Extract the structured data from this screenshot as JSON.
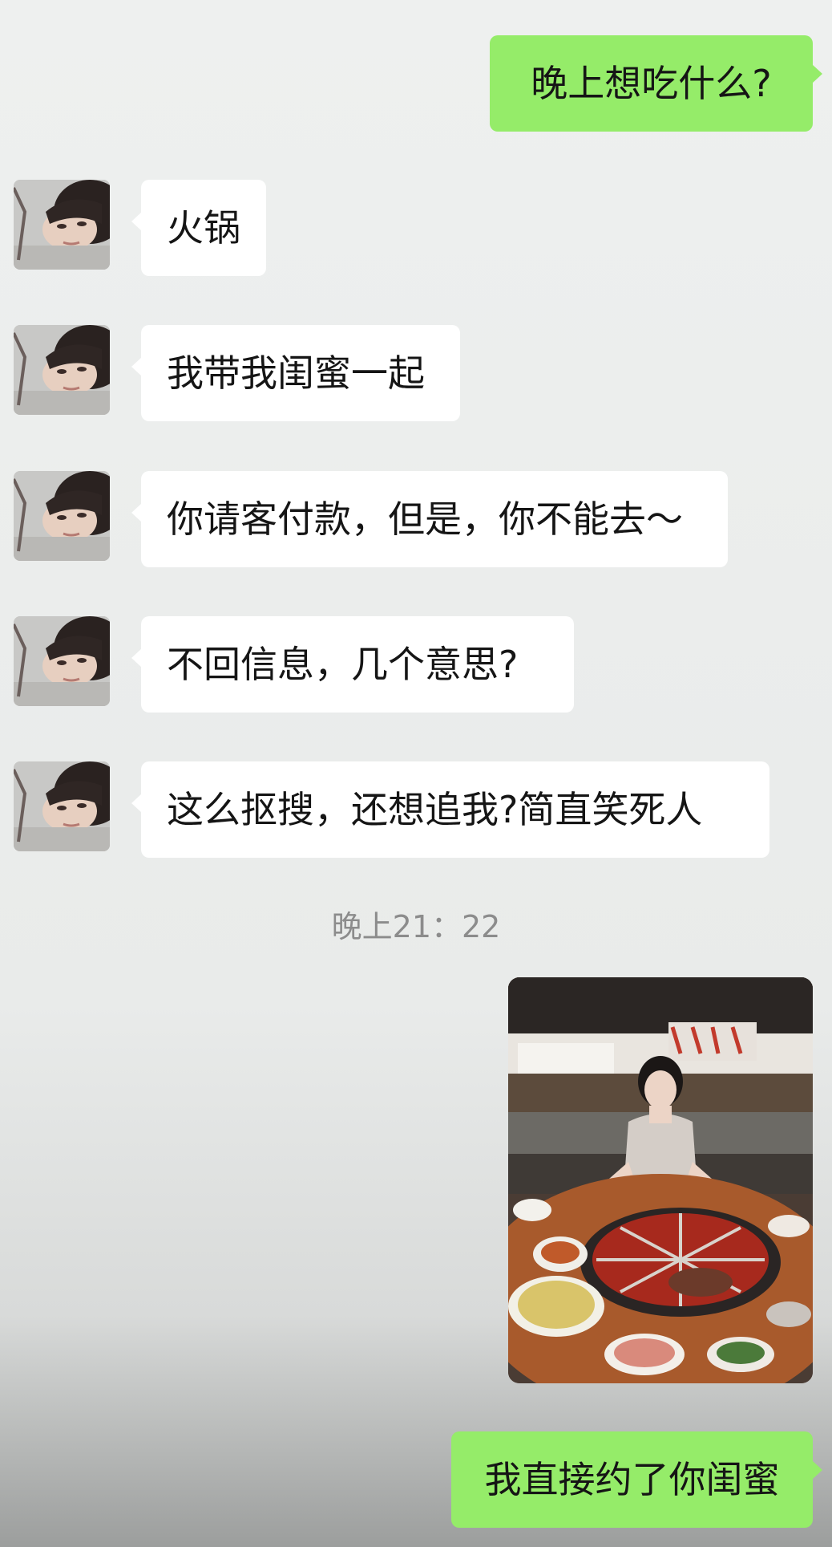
{
  "chat": {
    "messages": [
      {
        "sender": "me",
        "type": "text",
        "text": "晚上想吃什么?"
      },
      {
        "sender": "other",
        "type": "text",
        "text": "火锅",
        "avatar": "woman-avatar"
      },
      {
        "sender": "other",
        "type": "text",
        "text": "我带我闺蜜一起",
        "avatar": "woman-avatar"
      },
      {
        "sender": "other",
        "type": "text",
        "text": "你请客付款，但是，你不能去～",
        "avatar": "woman-avatar"
      },
      {
        "sender": "other",
        "type": "text",
        "text": "不回信息，几个意思?",
        "avatar": "woman-avatar"
      },
      {
        "sender": "other",
        "type": "text",
        "text": "这么抠搜，还想追我?简直笑死人",
        "avatar": "woman-avatar"
      }
    ],
    "timestamp": "晚上21：22",
    "image_message": {
      "sender": "me",
      "type": "image",
      "subject": "hotpot-photo"
    },
    "last_message": {
      "sender": "me",
      "type": "text",
      "text": "我直接约了你闺蜜"
    }
  },
  "colors": {
    "background": "#eceeed",
    "sent_bubble": "#95ec69",
    "received_bubble": "#ffffff",
    "timestamp_text": "#8c8c8c"
  }
}
